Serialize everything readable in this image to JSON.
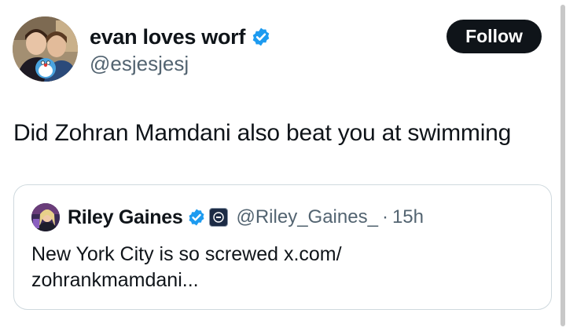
{
  "tweet": {
    "author": {
      "display_name": "evan loves worf",
      "handle": "@esjesjesj",
      "verified": true,
      "avatar_icon": "avatar-photo-icon"
    },
    "follow_label": "Follow",
    "text": "Did Zohran Mamdani also beat you at swimming",
    "colors": {
      "verified_blue": "#1d9bf0",
      "text_primary": "#0f1419",
      "text_secondary": "#536471",
      "border": "#cfd9de"
    }
  },
  "quote": {
    "author": {
      "display_name": "Riley Gaines",
      "handle": "@Riley_Gaines_",
      "verified": true,
      "affiliate_badge_icon": "affiliate-badge-icon"
    },
    "separator": "·",
    "time": "15h",
    "text_line1": "New York City is so screwed x.com/",
    "text_line2": "zohrankmamdani..."
  }
}
